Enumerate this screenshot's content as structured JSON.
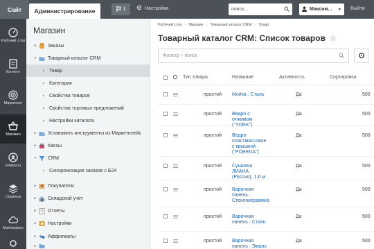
{
  "topbar": {
    "site_tab": "Сайт",
    "admin_tab": "Администрирование",
    "notifications_count": "1",
    "settings_label": "Настройки",
    "search_placeholder": "поиск...",
    "user_name": "Максим...",
    "logout_label": "Выйти"
  },
  "leftbar": {
    "items": [
      {
        "label": "Рабочий стол",
        "icon": "gauge-icon"
      },
      {
        "label": "Контент",
        "icon": "content-icon"
      },
      {
        "label": "Маркетинг",
        "icon": "target-icon"
      },
      {
        "label": "Магазин",
        "icon": "basket-icon"
      },
      {
        "label": "Клиенты",
        "icon": "clients-icon"
      },
      {
        "label": "Сервисы",
        "icon": "layers-icon"
      },
      {
        "label": "Marketplace",
        "icon": "cloud-icon"
      }
    ]
  },
  "menu": {
    "title": "Магазин",
    "items": [
      {
        "label": "Заказы",
        "arrow": "►"
      },
      {
        "label": "Товарный каталог CRM",
        "arrow": "▼"
      },
      {
        "label": "Товар",
        "arrow": ""
      },
      {
        "label": "Категория",
        "arrow": ""
      },
      {
        "label": "Свойства товаров",
        "arrow": ""
      },
      {
        "label": "Свойства торговых предложений",
        "arrow": ""
      },
      {
        "label": "Настройки каталога",
        "arrow": ""
      },
      {
        "label": "Установить инструменты из Маркетплейс",
        "arrow": "►"
      },
      {
        "label": "Кассы",
        "arrow": "►"
      },
      {
        "label": "CRM",
        "arrow": "▼"
      },
      {
        "label": "Синхронизация заказов с Б24",
        "arrow": ""
      },
      {
        "label": "Покупатели",
        "arrow": "►"
      },
      {
        "label": "Складской учет",
        "arrow": "►"
      },
      {
        "label": "Отчёты",
        "arrow": "►"
      },
      {
        "label": "Настройки",
        "arrow": "►"
      },
      {
        "label": "Аффилиаты",
        "arrow": "►"
      }
    ]
  },
  "main": {
    "breadcrumbs": [
      "Рабочий стол",
      "Магазин",
      "Товарный каталог CRM",
      "Товар"
    ],
    "title": "Товарный каталог CRM: Список товаров",
    "filter_placeholder": "Фильтр + поиск",
    "columns": {
      "type": "Тип товара",
      "name": "Название",
      "active": "Активность",
      "sort": "Сортировка"
    },
    "rows": [
      {
        "type": "простой",
        "name": [
          "Мойка : Сталь"
        ],
        "active": "Да",
        "sort": "500"
      },
      {
        "type": "простой",
        "name": [
          "Ведро с",
          "отжимом",
          "(\"YORK\")"
        ],
        "active": "Да",
        "sort": "500"
      },
      {
        "type": "простой",
        "name": [
          "Ведро",
          "пластмассовое",
          "с крышкой",
          "(\"POBEDA\")"
        ],
        "active": "Да",
        "sort": "500"
      },
      {
        "type": "простой",
        "name": [
          "Сушилка",
          "ЛИАНА",
          "(Россия), 1,6 м"
        ],
        "active": "Да",
        "sort": "500"
      },
      {
        "type": "простой",
        "name": [
          "Варочная",
          "панель :",
          "Стеклокерамика"
        ],
        "active": "Да",
        "sort": "500"
      },
      {
        "type": "простой",
        "name": [
          "Варочная",
          "панель : Сталь"
        ],
        "active": "Да",
        "sort": "500"
      },
      {
        "type": "простой",
        "name": [
          "Варочная",
          "панель : Эмаль"
        ],
        "active": "Да",
        "sort": "500"
      }
    ]
  },
  "colors": {
    "topbar": "#4c5258",
    "leftbar": "#3e4449",
    "link": "#2067b0"
  }
}
